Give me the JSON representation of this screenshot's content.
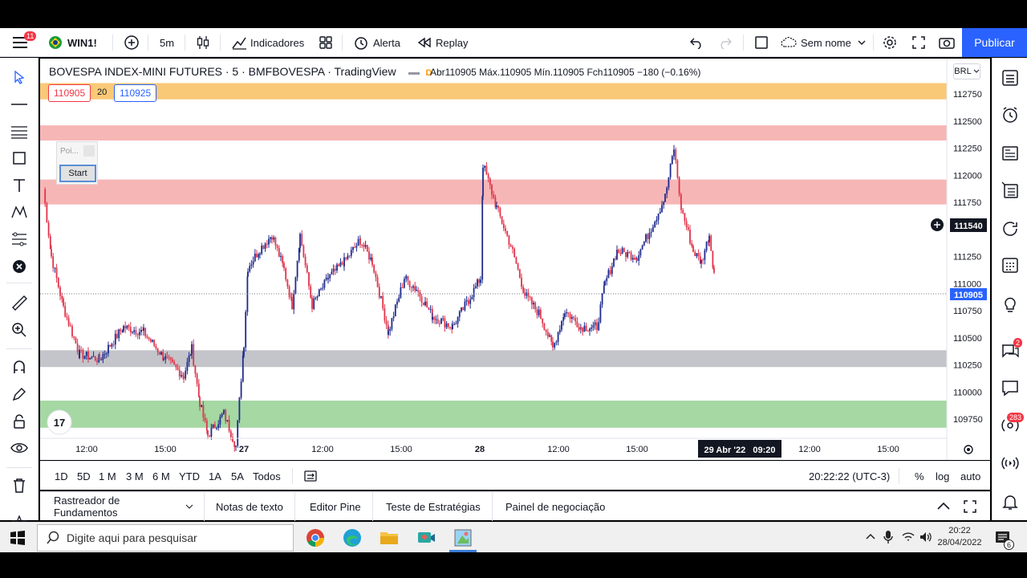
{
  "topbar": {
    "menu_badge": "11",
    "symbol": "WIN1!",
    "interval": "5m",
    "indicators": "Indicadores",
    "alert": "Alerta",
    "replay": "Replay",
    "layout_name": "Sem nome",
    "publish": "Publicar"
  },
  "legend": {
    "title": "BOVESPA INDEX-MINI FUTURES · 5 · BMFBOVESPA · TradingView",
    "market_status": "D",
    "ohlc": "Abr110905  Máx.110905  Mín.110905  Fch110905  −180 (−0.16%)",
    "bid": "110905",
    "spread": "20",
    "ask": "110925"
  },
  "widget": {
    "field_placeholder": "Poi...",
    "start_label": "Start"
  },
  "price_axis": {
    "currency": "BRL",
    "ticks": [
      "112750",
      "112500",
      "112250",
      "112000",
      "111750",
      "111540",
      "111250",
      "111000",
      "110905",
      "110750",
      "110500",
      "110250",
      "110000",
      "109750"
    ],
    "crosshair_price": "111540",
    "last_price": "110905"
  },
  "time_axis": {
    "ticks": [
      "12:00",
      "15:00",
      "27",
      "12:00",
      "15:00",
      "28",
      "12:00",
      "15:00",
      "12:00",
      "15:00"
    ],
    "crosshair_time": "29 Abr '22   09:20"
  },
  "chart_data": {
    "type": "candlestick",
    "symbol": "WIN1!",
    "interval": "5m",
    "ylim": [
      109560,
      112900
    ],
    "zones": [
      {
        "from": 112700,
        "to": 112850,
        "color": "#f9c977"
      },
      {
        "from": 112320,
        "to": 112460,
        "color": "#f7b6b6"
      },
      {
        "from": 111730,
        "to": 111960,
        "color": "#f7b6b6"
      },
      {
        "from": 110230,
        "to": 110385,
        "color": "#c3c5ca"
      },
      {
        "from": 109670,
        "to": 109920,
        "color": "#a5d8a3"
      }
    ],
    "path": [
      [
        0,
        111870
      ],
      [
        10,
        111250
      ],
      [
        25,
        110780
      ],
      [
        45,
        110350
      ],
      [
        70,
        110300
      ],
      [
        100,
        110600
      ],
      [
        125,
        110550
      ],
      [
        150,
        110320
      ],
      [
        175,
        110150
      ],
      [
        185,
        110400
      ],
      [
        195,
        109900
      ],
      [
        205,
        109600
      ],
      [
        225,
        109800
      ],
      [
        240,
        109500
      ],
      [
        250,
        110450
      ],
      [
        255,
        111150
      ],
      [
        270,
        111320
      ],
      [
        285,
        111450
      ],
      [
        300,
        111130
      ],
      [
        310,
        110800
      ],
      [
        320,
        111450
      ],
      [
        335,
        110800
      ],
      [
        355,
        111050
      ],
      [
        375,
        111200
      ],
      [
        395,
        111400
      ],
      [
        410,
        111200
      ],
      [
        430,
        110550
      ],
      [
        450,
        111050
      ],
      [
        465,
        110950
      ],
      [
        485,
        110700
      ],
      [
        510,
        110600
      ],
      [
        530,
        110850
      ],
      [
        545,
        111050
      ],
      [
        548,
        112100
      ],
      [
        565,
        111700
      ],
      [
        585,
        111300
      ],
      [
        600,
        110900
      ],
      [
        620,
        110700
      ],
      [
        635,
        110400
      ],
      [
        650,
        110750
      ],
      [
        670,
        110600
      ],
      [
        690,
        110600
      ],
      [
        700,
        111000
      ],
      [
        715,
        111300
      ],
      [
        740,
        111250
      ],
      [
        760,
        111550
      ],
      [
        775,
        111800
      ],
      [
        786,
        112250
      ],
      [
        795,
        111700
      ],
      [
        810,
        111300
      ],
      [
        820,
        111200
      ],
      [
        830,
        111450
      ],
      [
        836,
        111100
      ]
    ]
  },
  "bottom_toolbar": {
    "ranges": [
      "1D",
      "5D",
      "1 M",
      "3 M",
      "6 M",
      "YTD",
      "1A",
      "5A",
      "Todos"
    ],
    "clock": "20:22:22 (UTC-3)",
    "percent": "%",
    "log": "log",
    "auto": "auto"
  },
  "panels": [
    "Rastreador de Fundamentos",
    "Notas de texto",
    "Editor Pine",
    "Teste de Estratégias",
    "Painel de negociação"
  ],
  "right_toolbar": {
    "badge_chat": "2",
    "badge_ideas": "283"
  },
  "taskbar": {
    "search_placeholder": "Digite aqui para pesquisar",
    "time": "20:22",
    "date": "28/04/2022",
    "notif_count": "6"
  }
}
